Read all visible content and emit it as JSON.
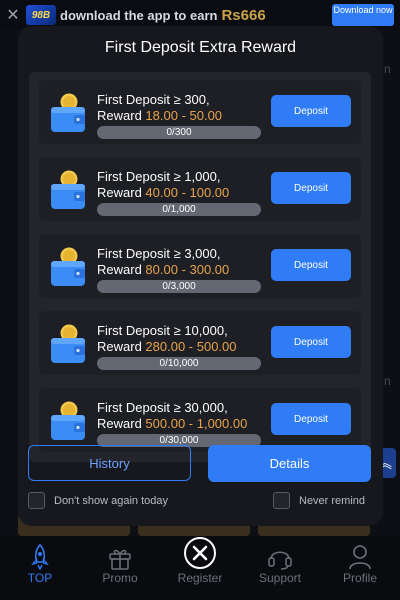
{
  "banner": {
    "close_icon": "close-icon",
    "logo_text": "98B",
    "text": "download the app to earn",
    "amount": "Rs666",
    "download_label": "Download now"
  },
  "modal": {
    "title": "First Deposit Extra Reward",
    "items": [
      {
        "condition": "First Deposit ≥ 300,",
        "reward_prefix": "Reward",
        "reward": "18.00 - 50.00",
        "progress": "0/300",
        "progress_fraction": 0,
        "button": "Deposit",
        "icon": "wallet-coin-icon"
      },
      {
        "condition": "First Deposit ≥ 1,000,",
        "reward_prefix": "Reward",
        "reward": "40.00 - 100.00",
        "progress": "0/1,000",
        "progress_fraction": 0,
        "button": "Deposit",
        "icon": "wallet-coin-icon"
      },
      {
        "condition": "First Deposit ≥ 3,000,",
        "reward_prefix": "Reward",
        "reward": "80.00 - 300.00",
        "progress": "0/3,000",
        "progress_fraction": 0,
        "button": "Deposit",
        "icon": "wallet-coin-icon"
      },
      {
        "condition": "First Deposit ≥ 10,000,",
        "reward_prefix": "Reward",
        "reward": "280.00 - 500.00",
        "progress": "0/10,000",
        "progress_fraction": 0,
        "button": "Deposit",
        "icon": "wallet-coin-icon"
      },
      {
        "condition": "First Deposit ≥ 30,000,",
        "reward_prefix": "Reward",
        "reward": "500.00 - 1,000.00",
        "progress": "0/30,000",
        "progress_fraction": 0,
        "button": "Deposit",
        "icon": "wallet-coin-icon"
      }
    ],
    "history_label": "History",
    "details_label": "Details",
    "dont_show_label": "Don't show again today",
    "never_remind_label": "Never remind"
  },
  "nav": {
    "items": [
      {
        "label": "TOP",
        "icon": "rocket-icon",
        "active": true
      },
      {
        "label": "Promo",
        "icon": "gift-icon",
        "active": false
      },
      {
        "label": "Register",
        "icon": "close-circle-icon",
        "active": false
      },
      {
        "label": "Support",
        "icon": "headset-icon",
        "active": false
      },
      {
        "label": "Profile",
        "icon": "user-icon",
        "active": false
      }
    ]
  },
  "colors": {
    "accent": "#2f7cf6",
    "reward": "#e8a24c",
    "modal_bg": "#16181d",
    "card_bg": "#1d1f24"
  }
}
